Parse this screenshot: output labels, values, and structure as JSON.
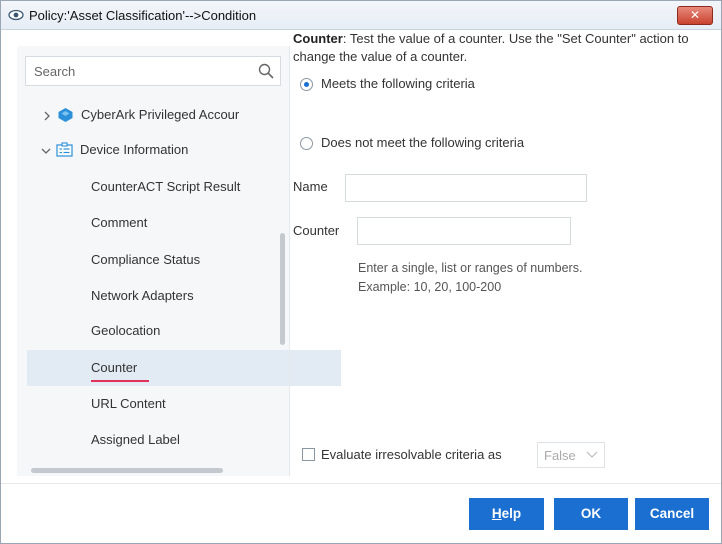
{
  "window": {
    "title": "Policy:'Asset Classification'-->Condition",
    "close_label": "✕"
  },
  "search": {
    "placeholder": "Search"
  },
  "tree": {
    "groups": [
      {
        "label": "CyberArk Privileged Accour",
        "expanded": false
      },
      {
        "label": "Device Information",
        "expanded": true
      }
    ],
    "items": [
      {
        "label": "CounterACT Script Result"
      },
      {
        "label": "Comment"
      },
      {
        "label": "Compliance Status"
      },
      {
        "label": "Network Adapters"
      },
      {
        "label": "Geolocation"
      },
      {
        "label": "Counter",
        "selected": true
      },
      {
        "label": "URL Content"
      },
      {
        "label": "Assigned Label"
      }
    ]
  },
  "condition": {
    "heading": "Counter",
    "description": ": Test the value of a counter. Use the \"Set Counter\" action to change the value of a counter.",
    "radio_meets": "Meets the following criteria",
    "radio_not_meets": "Does not meet the following criteria",
    "selected_option": "meets",
    "name_label": "Name",
    "name_value": "",
    "counter_label": "Counter",
    "counter_value": "",
    "hint_line1": "Enter a single, list or ranges of numbers.",
    "hint_line2": "Example: 10, 20, 100-200",
    "evaluate_label": "Evaluate irresolvable criteria as",
    "evaluate_checked": false,
    "evaluate_value": "False"
  },
  "buttons": {
    "help_mnemonic": "H",
    "help_rest": "elp",
    "ok": "OK",
    "cancel": "Cancel"
  },
  "colors": {
    "accent": "#1a6fd1",
    "selection_bg": "#e2ebf3",
    "selection_underline": "#e0325a",
    "cyberark_icon": "#2b8fd9"
  }
}
